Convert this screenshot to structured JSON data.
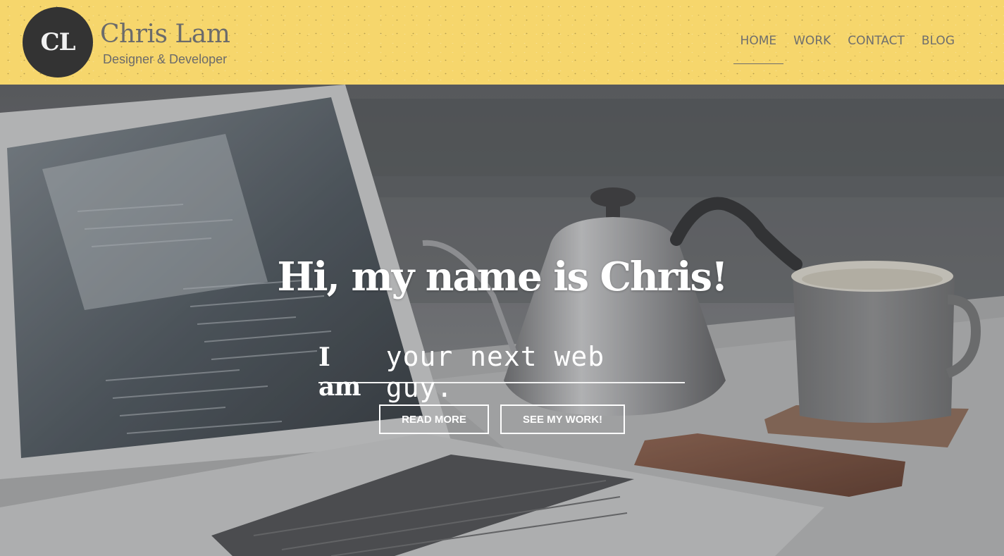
{
  "header": {
    "logo_initials": "CL",
    "name": "Chris Lam",
    "tagline": "Designer & Developer",
    "background_color": "#f6d66c"
  },
  "nav": {
    "items": [
      {
        "label": "HOME",
        "active": true
      },
      {
        "label": "WORK",
        "active": false
      },
      {
        "label": "CONTACT",
        "active": false
      },
      {
        "label": "BLOG",
        "active": false
      }
    ]
  },
  "hero": {
    "title": "Hi, my name is Chris!",
    "lead": "I am",
    "typed": "your next web guy.",
    "buttons": {
      "read_more": "READ MORE",
      "see_work": "SEE MY WORK!"
    },
    "photo_description_icon": "laptop-kettle-mug-photo"
  }
}
